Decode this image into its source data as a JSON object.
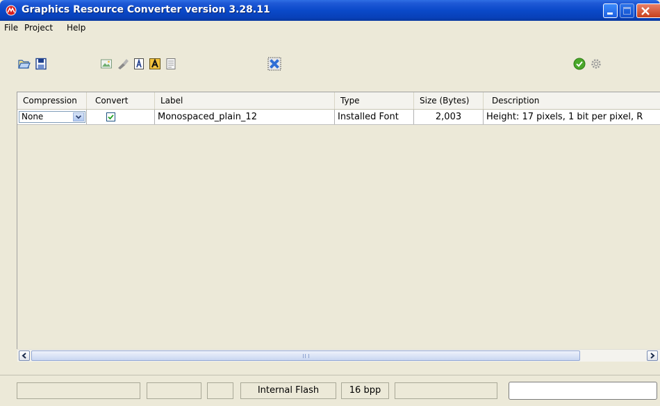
{
  "window": {
    "title": "Graphics Resource Converter version 3.28.11"
  },
  "menu": [
    "File",
    "Project",
    "Help"
  ],
  "table": {
    "headers": [
      "Compression",
      "Convert",
      "Label",
      "Type",
      "Size (Bytes)",
      "Description"
    ],
    "rows": [
      {
        "compression": "None",
        "convert": true,
        "label": "Monospaced_plain_12",
        "type": "Installed Font",
        "size": "2,003",
        "description": "Height: 17 pixels, 1 bit per pixel, R"
      }
    ]
  },
  "status": {
    "memory": "Internal Flash",
    "bpp": "16 bpp"
  },
  "icons": {
    "app": "microchip-logo-icon",
    "open": "open-folder-icon",
    "save": "save-icon",
    "add_image": "add-image-icon",
    "tools": "tools-icon",
    "add_font": "add-font-icon",
    "add_installed_font": "add-installed-font-icon",
    "add_binary": "add-binary-icon",
    "remove": "remove-resource-icon",
    "generate": "generate-check-icon",
    "settings": "settings-gear-icon"
  }
}
